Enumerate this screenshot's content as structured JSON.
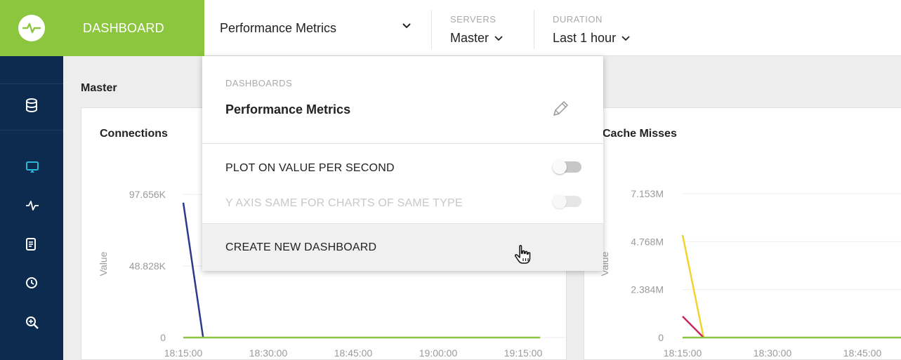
{
  "header": {
    "app_tab": "DASHBOARD",
    "dashboard_select": "Performance Metrics",
    "servers": {
      "label": "SERVERS",
      "value": "Master"
    },
    "duration": {
      "label": "DURATION",
      "value": "Last 1 hour"
    }
  },
  "sidebar": {
    "items": [
      {
        "icon": "database-icon"
      },
      {
        "icon": "monitor-icon"
      },
      {
        "icon": "pulse-icon"
      },
      {
        "icon": "document-icon"
      },
      {
        "icon": "clock-icon"
      },
      {
        "icon": "zoom-in-icon"
      }
    ],
    "active_color": "#29b6d6"
  },
  "main": {
    "server_title": "Master",
    "panels": [
      {
        "title": "Connections"
      },
      {
        "title": "Cache Misses"
      }
    ]
  },
  "dropdown": {
    "section_label": "DASHBOARDS",
    "current": "Performance Metrics",
    "option_plot_per_second": "PLOT ON VALUE PER SECOND",
    "option_same_y_axis": "Y AXIS SAME FOR CHARTS OF SAME TYPE",
    "create_new": "CREATE NEW DASHBOARD"
  },
  "colors": {
    "brand_green": "#8cc63f",
    "sidebar_navy": "#0d2b4e",
    "series_blue": "#2b3a8a",
    "series_green": "#8cc63f",
    "series_yellow": "#f2d32f",
    "series_crimson": "#c8285a"
  },
  "chart_data": [
    {
      "type": "line",
      "title": "Connections",
      "ylabel": "Value",
      "yticks": [
        "97.656K",
        "48.828K",
        "0"
      ],
      "xticks": [
        "18:15:00",
        "18:30:00",
        "18:45:00",
        "19:00:00",
        "19:15:00"
      ],
      "series": [
        {
          "color": "#2b3a8a",
          "points": [
            [
              "18:15:00",
              92000
            ],
            [
              "18:18:30",
              0
            ]
          ]
        },
        {
          "color": "#8cc63f",
          "points": [
            [
              "18:15:00",
              0
            ],
            [
              "19:18:00",
              0
            ]
          ]
        }
      ]
    },
    {
      "type": "line",
      "title": "Cache Misses",
      "ylabel": "Value",
      "yticks": [
        "7.153M",
        "4.768M",
        "2.384M",
        "0"
      ],
      "xticks": [
        "18:15:00",
        "18:30:00",
        "18:45:00"
      ],
      "series": [
        {
          "color": "#f2d32f",
          "points": [
            [
              "18:15:00",
              5100000
            ],
            [
              "18:18:30",
              0
            ]
          ]
        },
        {
          "color": "#c8285a",
          "points": [
            [
              "18:15:00",
              1050000
            ],
            [
              "18:18:30",
              0
            ]
          ]
        },
        {
          "color": "#8cc63f",
          "points": [
            [
              "18:15:00",
              0
            ],
            [
              "18:55:00",
              0
            ]
          ]
        }
      ]
    }
  ]
}
